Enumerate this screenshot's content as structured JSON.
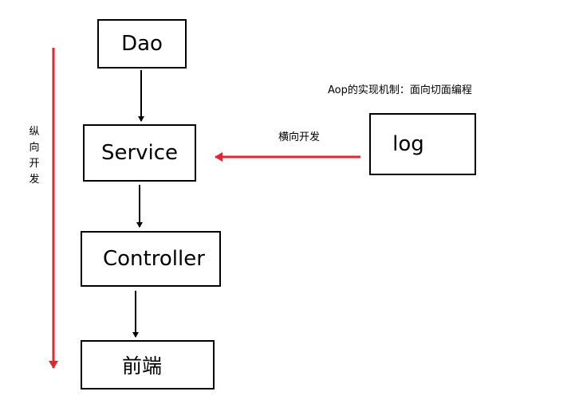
{
  "boxes": {
    "dao": "Dao",
    "service": "Service",
    "controller": "Controller",
    "frontend": "前端",
    "log": "log"
  },
  "labels": {
    "aop_caption": "Aop的实现机制：面向切面编程",
    "horizontal": "横向开发",
    "vertical": "纵向开发"
  },
  "colors": {
    "box_border": "#000000",
    "black_arrow": "#000000",
    "red_arrow": "#e0262e"
  }
}
